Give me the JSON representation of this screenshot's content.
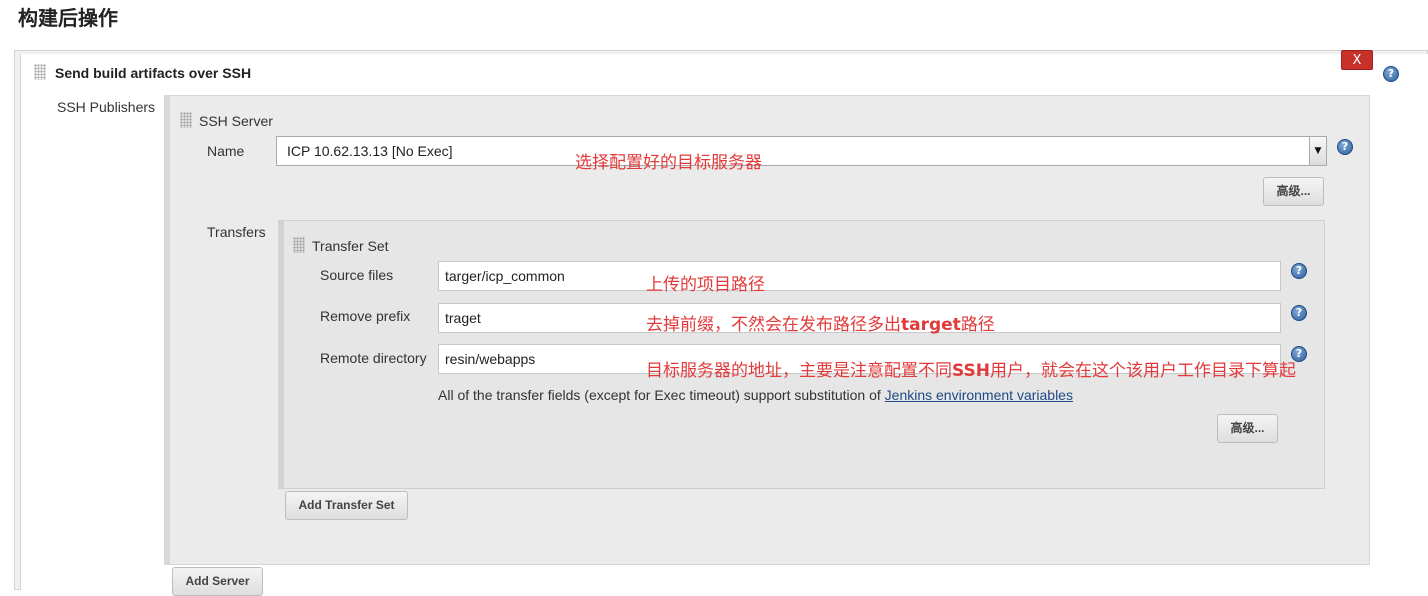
{
  "section": {
    "title": "构建后操作"
  },
  "plugin": {
    "title": "Send build artifacts over SSH",
    "close_label": "X",
    "publishers_label": "SSH Publishers"
  },
  "ssh_server": {
    "title": "SSH Server",
    "name_label": "Name",
    "name_value": "ICP 10.62.13.13 [No Exec]",
    "advanced_label": "高级...",
    "transfers_label": "Transfers"
  },
  "transfer_set": {
    "title": "Transfer Set",
    "source_label": "Source files",
    "source_value": "targer/icp_common",
    "prefix_label": "Remove prefix",
    "prefix_value": "traget",
    "remote_label": "Remote directory",
    "remote_value": "resin/webapps",
    "info_text": "All of the transfer fields (except for Exec timeout) support substitution of ",
    "info_link": "Jenkins environment variables",
    "advanced_label": "高级...",
    "add_transfer_label": "Add Transfer Set"
  },
  "add_server_label": "Add Server",
  "annotations": {
    "name_note": "选择配置好的目标服务器",
    "source_note": "上传的项目路径",
    "prefix_note_a": "去掉前缀，不然会在发布路径多出",
    "prefix_note_b": "target",
    "prefix_note_c": "路径",
    "remote_note_a": "目标服务器的地址，主要是注意配置不同",
    "remote_note_b": "SSH",
    "remote_note_c": "用户，就会在这个该用户工作目录下算起"
  },
  "help_glyph": "?",
  "colors": {
    "annotation": "#e23a3a",
    "close": "#c8302a",
    "link": "#204a87"
  }
}
